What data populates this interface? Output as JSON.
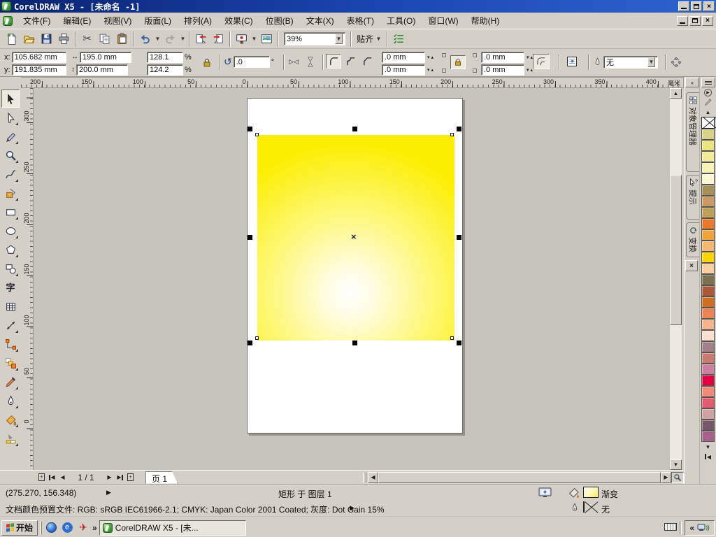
{
  "titlebar": {
    "title": "CorelDRAW X5 - [未命名 -1]"
  },
  "menubar": {
    "items": [
      "文件(F)",
      "编辑(E)",
      "视图(V)",
      "版面(L)",
      "排列(A)",
      "效果(C)",
      "位图(B)",
      "文本(X)",
      "表格(T)",
      "工具(O)",
      "窗口(W)",
      "帮助(H)"
    ]
  },
  "toolbar": {
    "buttons": [
      "new-document",
      "open",
      "save",
      "print",
      "cut",
      "copy",
      "paste",
      "undo",
      "redo",
      "import",
      "export",
      "application-launcher",
      "welcome-screen"
    ],
    "zoom_level": "39%",
    "snap_label": "贴齐"
  },
  "property_bar": {
    "x_label": "x:",
    "x_value": "105.682 mm",
    "y_label": "y:",
    "y_value": "191.835 mm",
    "width_value": "195.0 mm",
    "height_value": "200.0 mm",
    "scale_h": "128.1",
    "scale_v": "124.2",
    "percent": "%",
    "angle_value": ".0",
    "degree": "°",
    "corner_tl": ".0 mm",
    "corner_tr": ".0 mm",
    "corner_bl": ".0 mm",
    "corner_br": ".0 mm",
    "outline_width": "无"
  },
  "rulers": {
    "h_labels": [
      "200",
      "150",
      "100",
      "50",
      "0",
      "50",
      "100",
      "150",
      "200",
      "250",
      "300",
      "350",
      "400"
    ],
    "v_labels": [
      "300",
      "250",
      "200",
      "150",
      "100",
      "50",
      "0"
    ],
    "unit": "毫米"
  },
  "toolbox": {
    "selected": "pick-tool",
    "text_tool_glyph": "字",
    "tools": [
      "pick-tool",
      "shape-tool",
      "crop-tool",
      "zoom-tool",
      "freehand-tool",
      "smart-fill-tool",
      "rectangle-tool",
      "ellipse-tool",
      "polygon-tool",
      "basic-shapes-tool",
      "text-tool",
      "table-tool",
      "parallel-dimension-tool",
      "straight-line-connector-tool",
      "blend-tool",
      "color-eyedropper-tool",
      "outline-pen-tool",
      "fill-tool",
      "interactive-fill-tool"
    ]
  },
  "canvas": {
    "gradient_inner": "#ffffff",
    "gradient_outer": "#fcee00"
  },
  "dockers": {
    "tabs": [
      "对象管理器",
      "提示",
      "变换"
    ]
  },
  "palette": {
    "colors": [
      "#d8d28b",
      "#eae47e",
      "#f1ec9b",
      "#f6f2b8",
      "#fbf7d7",
      "#a68f5b",
      "#cb9a65",
      "#bda05a",
      "#e9782b",
      "#f0a23c",
      "#f4b872",
      "#fed503",
      "#f8d0a1",
      "#7c7052",
      "#aa5a3b",
      "#cf6f21",
      "#ee8357",
      "#f6b38f",
      "#f9dfd0",
      "#a1808a",
      "#c77a6f",
      "#cd7fa0",
      "#e30040",
      "#f08a7c",
      "#e45b70",
      "#cfa2a2",
      "#775869",
      "#a6628a"
    ]
  },
  "page_nav": {
    "counter": "1 / 1",
    "page_tab": "页 1"
  },
  "status_bar": {
    "coords": "(275.270, 156.348)",
    "selection_info": "矩形 于 图层 1",
    "fill_label": "渐变",
    "outline_label": "无",
    "profile": "文档颜色预置文件: RGB: sRGB IEC61966-2.1; CMYK: Japan Color 2001 Coated; 灰度: Dot Gain 15%"
  },
  "taskbar": {
    "start_label": "开始",
    "task_button": "CorelDRAW X5 - [未...",
    "overflow_glyph": "»",
    "tray_collapse_glyph": "«"
  }
}
